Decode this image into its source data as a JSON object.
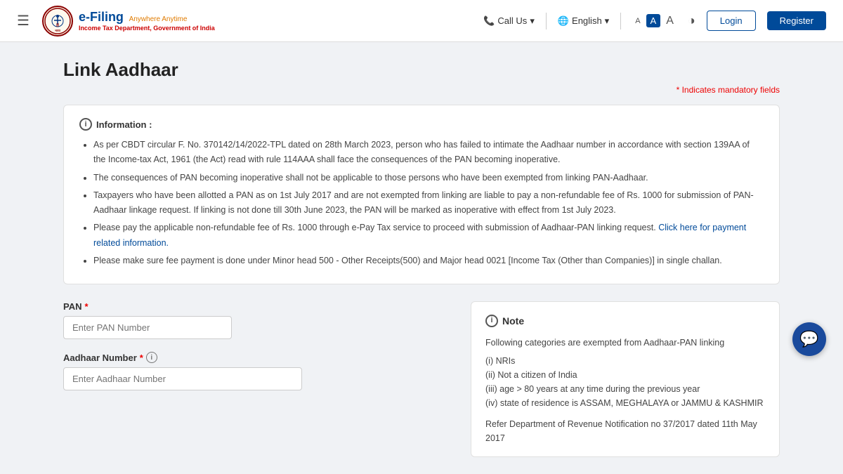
{
  "header": {
    "hamburger_label": "☰",
    "logo_efiling": "e-Filing",
    "logo_tagline": "Anywhere Anytime",
    "logo_subtitle": "Income Tax Department, Government of India",
    "call_us_label": "Call Us",
    "call_us_icon": "📞",
    "lang_icon": "🌐",
    "lang_label": "English",
    "lang_arrow": "▾",
    "font_small": "A",
    "font_medium": "A",
    "font_large": "A",
    "contrast_icon": "◑",
    "login_label": "Login",
    "register_label": "Register"
  },
  "page": {
    "title": "Link Aadhaar",
    "mandatory_note": "* Indicates mandatory fields"
  },
  "info_box": {
    "header": "Information :",
    "icon": "i",
    "bullets": [
      "As per CBDT circular F. No. 370142/14/2022-TPL dated on 28th March 2023, person who has failed to intimate the Aadhaar number in accordance with section 139AA of the Income-tax Act, 1961 (the Act) read with rule 114AAA shall face the consequences of the PAN becoming inoperative.",
      "The consequences of PAN becoming inoperative shall not be applicable to those persons who have been exempted from linking PAN-Aadhaar.",
      "Taxpayers who have been allotted a PAN as on 1st July 2017 and are not exempted from linking are liable to pay a non-refundable fee of Rs. 1000 for submission of PAN-Aadhaar linkage request. If linking is not done till 30th June 2023, the PAN will be marked as inoperative with effect from 1st July 2023.",
      "Please pay the applicable non-refundable fee of Rs. 1000 through e-Pay Tax service to proceed with submission of Aadhaar-PAN linking request.",
      "Please make sure fee payment is done under Minor head 500 - Other Receipts(500) and Major head 0021 [Income Tax (Other than Companies)] in single challan."
    ],
    "link_text": "Click here for payment related information."
  },
  "form": {
    "pan_label": "PAN",
    "pan_required": "*",
    "pan_placeholder": "Enter PAN Number",
    "aadhaar_label": "Aadhaar Number",
    "aadhaar_required": "*",
    "aadhaar_placeholder": "Enter Aadhaar Number"
  },
  "note_box": {
    "header": "Note",
    "icon": "i",
    "intro": "Following categories are exempted from Aadhaar-PAN linking",
    "items": [
      "(i) NRIs",
      "(ii) Not a citizen of India",
      "(iii) age > 80 years at any time during the previous year",
      "(iv) state of residence is ASSAM, MEGHALAYA or JAMMU & KASHMIR"
    ],
    "footer": "Refer Department of Revenue Notification no 37/2017 dated 11th May 2017"
  },
  "chat_button": {
    "icon": "💬"
  }
}
